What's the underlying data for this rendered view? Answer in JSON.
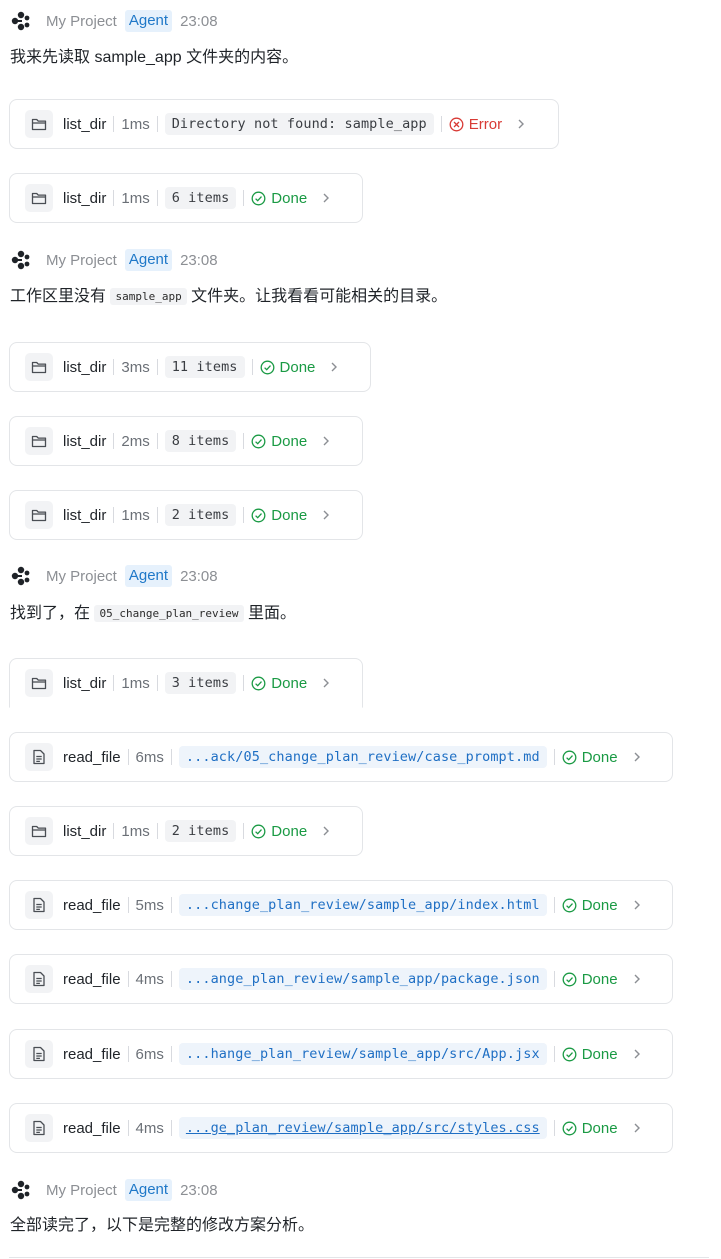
{
  "messages": [
    {
      "header": {
        "project": "My Project",
        "badge": "Agent",
        "time": "23:08"
      },
      "text": "我来先读取 sample_app 文件夹的内容。"
    },
    {
      "header": {
        "project": "My Project",
        "badge": "Agent",
        "time": "23:08"
      },
      "text_before": "工作区里没有",
      "code": "sample_app",
      "text_after": "文件夹。让我看看可能相关的目录。"
    },
    {
      "header": {
        "project": "My Project",
        "badge": "Agent",
        "time": "23:08"
      },
      "text_before": "找到了，在",
      "code": "05_change_plan_review",
      "text_after": "里面。"
    },
    {
      "header": {
        "project": "My Project",
        "badge": "Agent",
        "time": "23:08"
      },
      "text": "全部读完了，以下是完整的修改方案分析。"
    }
  ],
  "tools": [
    {
      "icon": "folder-icon",
      "name": "list_dir",
      "duration": "1ms",
      "detail": "Directory not found: sample_app",
      "status": "Error",
      "status_type": "error"
    },
    {
      "icon": "folder-icon",
      "name": "list_dir",
      "duration": "1ms",
      "detail": "6 items",
      "status": "Done",
      "status_type": "done"
    },
    {
      "icon": "folder-icon",
      "name": "list_dir",
      "duration": "3ms",
      "detail": "11 items",
      "status": "Done",
      "status_type": "done"
    },
    {
      "icon": "folder-icon",
      "name": "list_dir",
      "duration": "2ms",
      "detail": "8 items",
      "status": "Done",
      "status_type": "done"
    },
    {
      "icon": "folder-icon",
      "name": "list_dir",
      "duration": "1ms",
      "detail": "2 items",
      "status": "Done",
      "status_type": "done"
    },
    {
      "icon": "folder-icon",
      "name": "list_dir",
      "duration": "1ms",
      "detail": "3 items",
      "status": "Done",
      "status_type": "done"
    },
    {
      "icon": "file-icon",
      "name": "read_file",
      "duration": "6ms",
      "detail": "...ack/05_change_plan_review/case_prompt.md",
      "status": "Done",
      "status_type": "done"
    },
    {
      "icon": "folder-icon",
      "name": "list_dir",
      "duration": "1ms",
      "detail": "2 items",
      "status": "Done",
      "status_type": "done"
    },
    {
      "icon": "file-icon",
      "name": "read_file",
      "duration": "5ms",
      "detail": "...change_plan_review/sample_app/index.html",
      "status": "Done",
      "status_type": "done"
    },
    {
      "icon": "file-icon",
      "name": "read_file",
      "duration": "4ms",
      "detail": "...ange_plan_review/sample_app/package.json",
      "status": "Done",
      "status_type": "done"
    },
    {
      "icon": "file-icon",
      "name": "read_file",
      "duration": "6ms",
      "detail": "...hange_plan_review/sample_app/src/App.jsx",
      "status": "Done",
      "status_type": "done"
    },
    {
      "icon": "file-icon",
      "name": "read_file",
      "duration": "4ms",
      "detail": "...ge_plan_review/sample_app/src/styles.css",
      "status": "Done",
      "status_type": "done"
    }
  ],
  "colors": {
    "done": "#1a9a44",
    "error": "#d83a35",
    "badge_bg": "#e6f1fc",
    "badge_text": "#1f78c8",
    "path_text": "#1f6fc4"
  }
}
